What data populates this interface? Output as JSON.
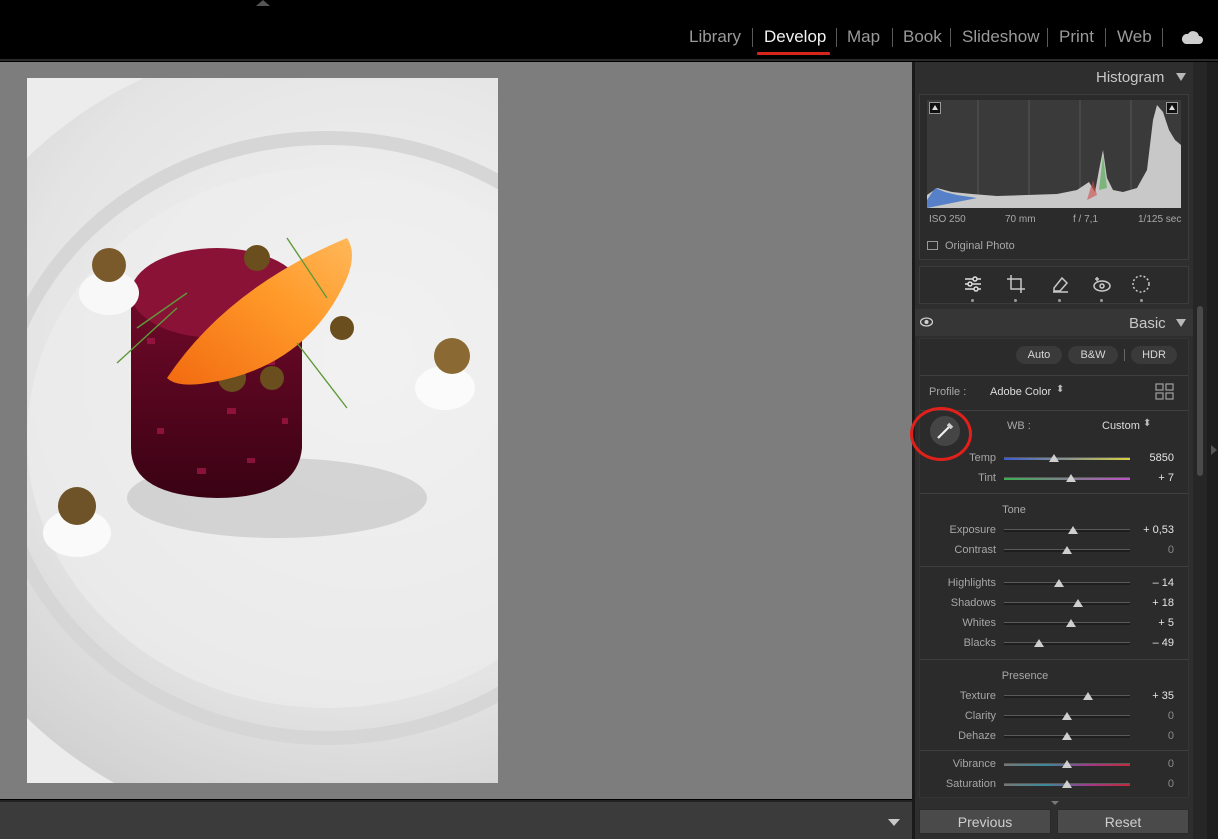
{
  "modules": [
    "Library",
    "Develop",
    "Map",
    "Book",
    "Slideshow",
    "Print",
    "Web"
  ],
  "active_module": "Develop",
  "histogram": {
    "title": "Histogram",
    "iso": "ISO 250",
    "focal": "70 mm",
    "aperture": "f / 7,1",
    "shutter": "1/125 sec",
    "original_photo": "Original Photo"
  },
  "basic": {
    "title": "Basic",
    "auto": "Auto",
    "bw": "B&W",
    "hdr": "HDR",
    "profile_label": "Profile :",
    "profile_value": "Adobe Color",
    "wb_label": "WB :",
    "wb_value": "Custom",
    "tone_title": "Tone",
    "presence_title": "Presence",
    "sliders": {
      "temp": {
        "label": "Temp",
        "value": "5850",
        "pos": 0.4
      },
      "tint": {
        "label": "Tint",
        "value": "+ 7",
        "pos": 0.53
      },
      "exposure": {
        "label": "Exposure",
        "value": "+ 0,53",
        "pos": 0.55
      },
      "contrast": {
        "label": "Contrast",
        "value": "0",
        "pos": 0.5
      },
      "highlights": {
        "label": "Highlights",
        "value": "– 14",
        "pos": 0.44
      },
      "shadows": {
        "label": "Shadows",
        "value": "+ 18",
        "pos": 0.59
      },
      "whites": {
        "label": "Whites",
        "value": "+ 5",
        "pos": 0.53
      },
      "blacks": {
        "label": "Blacks",
        "value": "– 49",
        "pos": 0.28
      },
      "texture": {
        "label": "Texture",
        "value": "+ 35",
        "pos": 0.67
      },
      "clarity": {
        "label": "Clarity",
        "value": "0",
        "pos": 0.5
      },
      "dehaze": {
        "label": "Dehaze",
        "value": "0",
        "pos": 0.5
      },
      "vibrance": {
        "label": "Vibrance",
        "value": "0",
        "pos": 0.5
      },
      "saturation": {
        "label": "Saturation",
        "value": "0",
        "pos": 0.5
      }
    }
  },
  "footer": {
    "previous": "Previous",
    "reset": "Reset"
  },
  "colors": {
    "accent": "#d6261c",
    "panel": "#2e2e2e",
    "canvas": "#7d7d7d"
  }
}
